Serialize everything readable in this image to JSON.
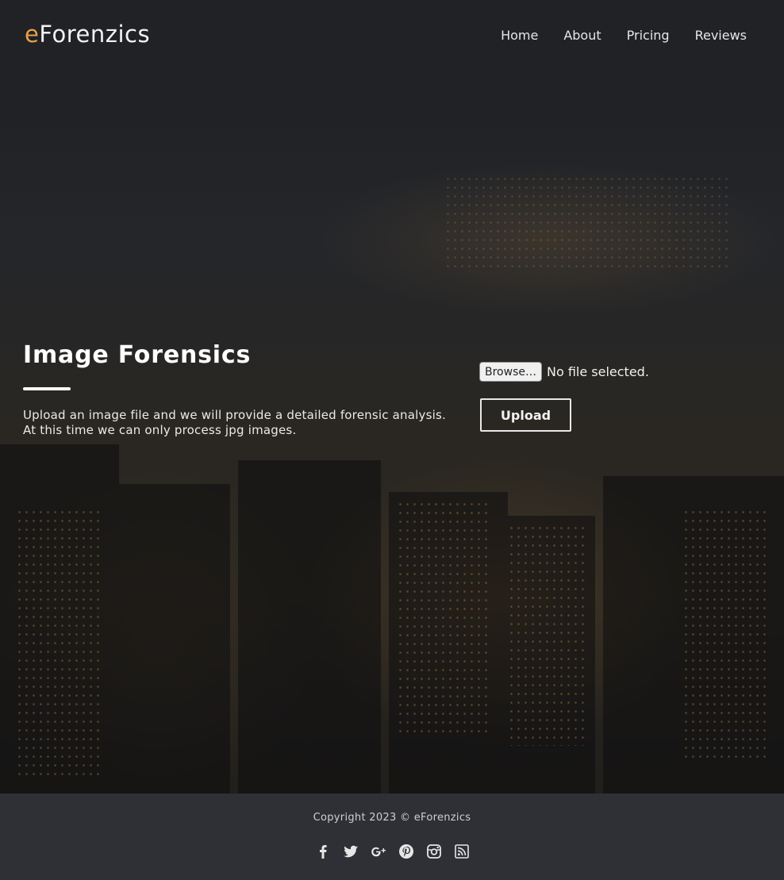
{
  "header": {
    "logo_accent": "e",
    "logo_rest": "Forenzics",
    "nav": [
      {
        "label": "Home"
      },
      {
        "label": "About"
      },
      {
        "label": "Pricing"
      },
      {
        "label": "Reviews"
      }
    ]
  },
  "main": {
    "title": "Image Forensics",
    "description_line1": "Upload an image file and we will provide a detailed forensic analysis.",
    "description_line2": "At this time we can only process jpg images.",
    "browse_label": "Browse…",
    "file_status": "No file selected.",
    "upload_label": "Upload"
  },
  "footer": {
    "copyright": "Copyright 2023 © eForenzics",
    "social_icons": [
      "facebook-icon",
      "twitter-icon",
      "google-plus-icon",
      "pinterest-icon",
      "instagram-icon",
      "rss-icon"
    ]
  },
  "colors": {
    "accent": "#e9a04b",
    "footer_bg": "#2f3035",
    "text": "#ffffff"
  }
}
